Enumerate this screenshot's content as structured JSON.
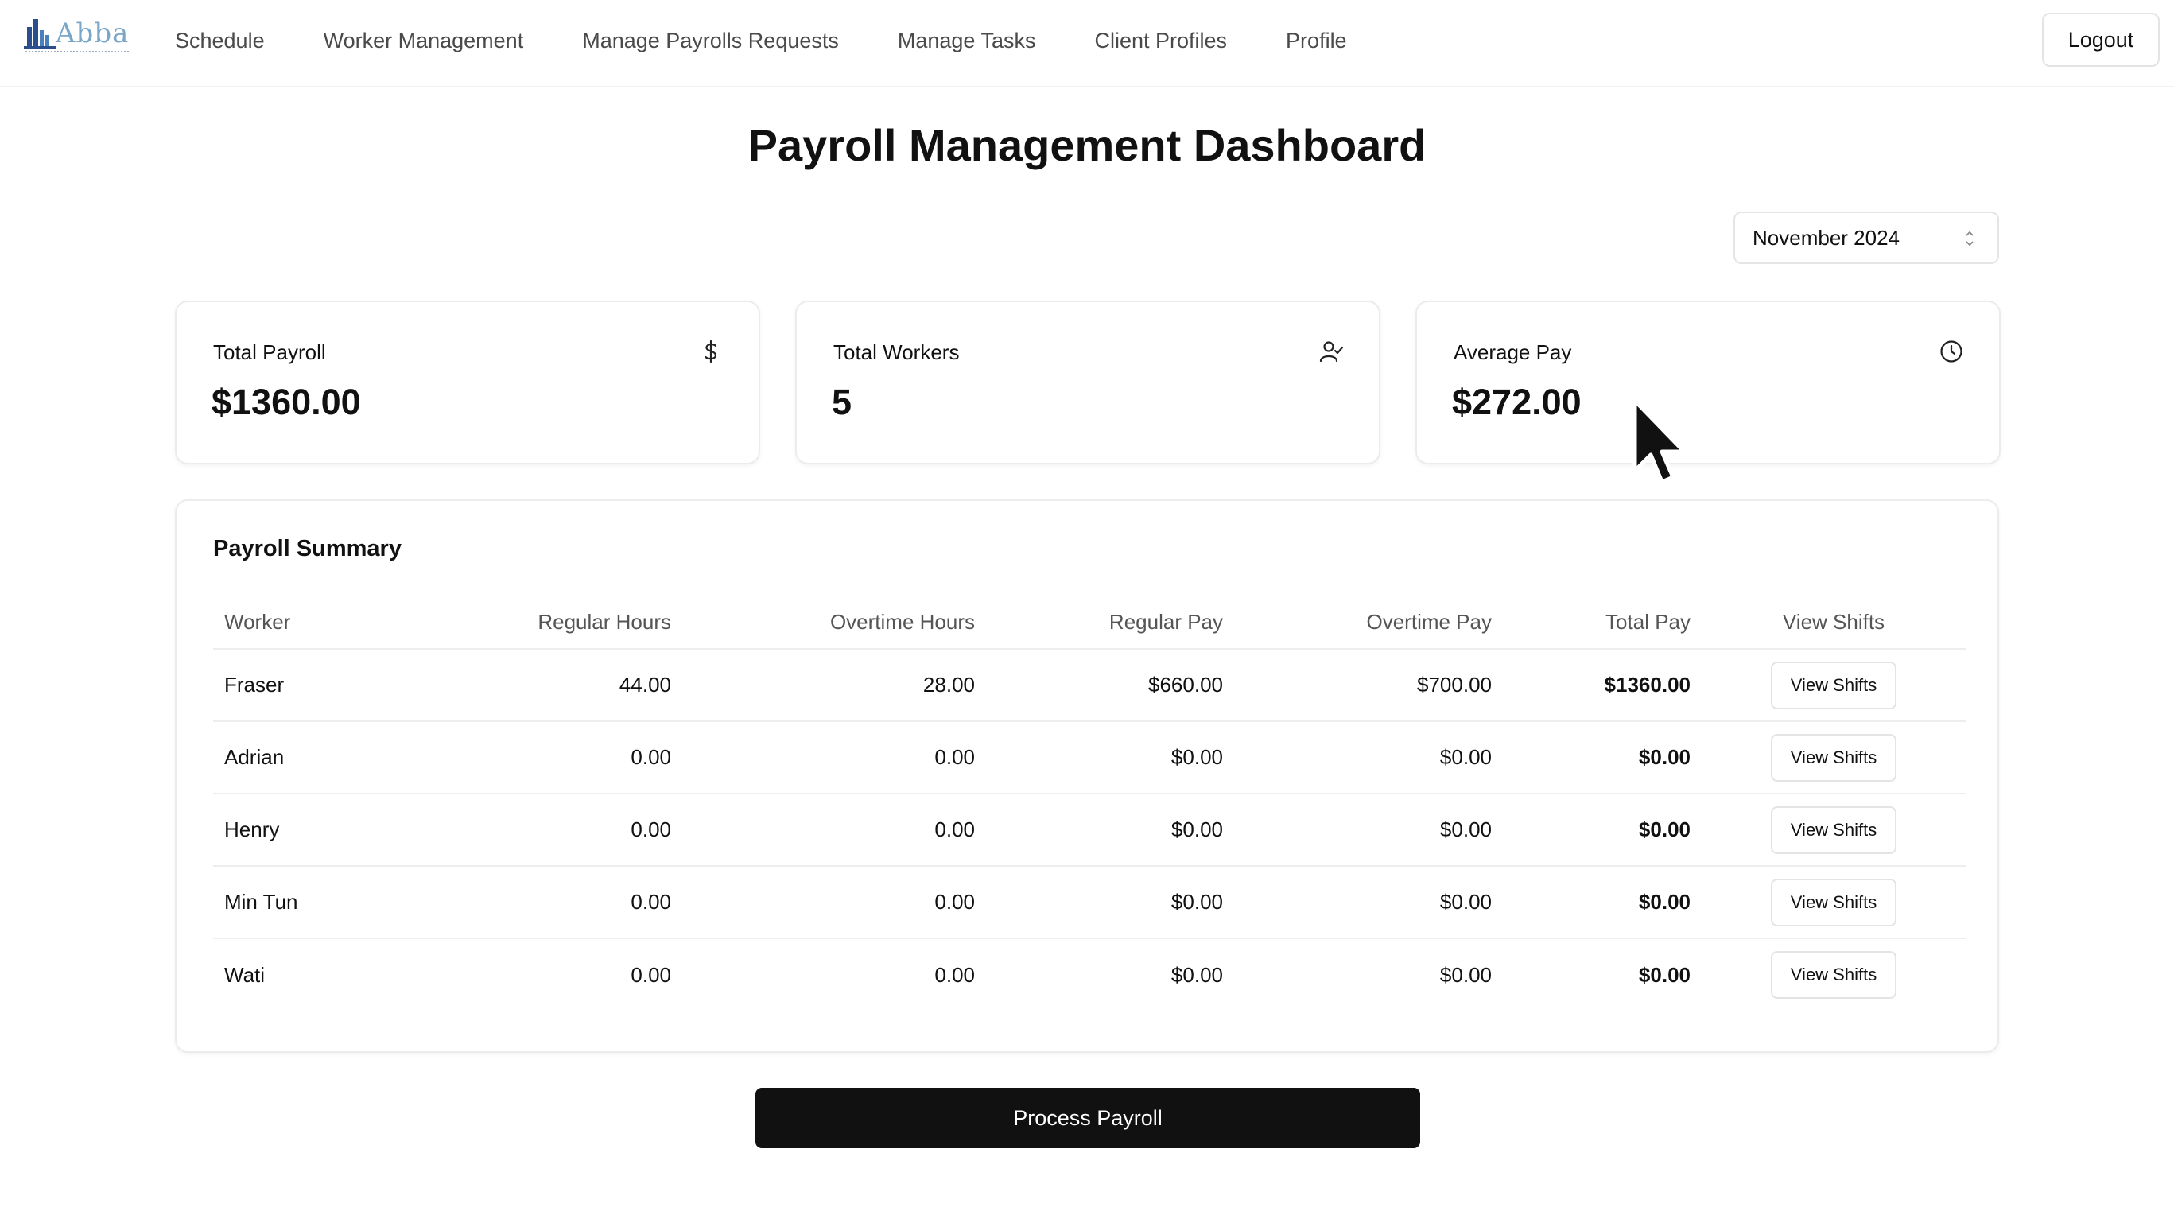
{
  "nav": {
    "logo_text": "Abba",
    "links": [
      "Schedule",
      "Worker Management",
      "Manage Payrolls Requests",
      "Manage Tasks",
      "Client Profiles",
      "Profile"
    ],
    "logout_label": "Logout"
  },
  "page": {
    "title": "Payroll Management Dashboard",
    "month_selected": "November 2024"
  },
  "stats": {
    "total_payroll": {
      "label": "Total Payroll",
      "value": "$1360.00",
      "icon": "dollar-icon"
    },
    "total_workers": {
      "label": "Total Workers",
      "value": "5",
      "icon": "user-icon"
    },
    "average_pay": {
      "label": "Average Pay",
      "value": "$272.00",
      "icon": "clock-icon"
    }
  },
  "summary": {
    "title": "Payroll Summary",
    "columns": [
      "Worker",
      "Regular Hours",
      "Overtime Hours",
      "Regular Pay",
      "Overtime Pay",
      "Total Pay",
      "View Shifts"
    ],
    "rows": [
      {
        "worker": "Fraser",
        "regular_hours": "44.00",
        "overtime_hours": "28.00",
        "regular_pay": "$660.00",
        "overtime_pay": "$700.00",
        "total_pay": "$1360.00",
        "action": "View Shifts"
      },
      {
        "worker": "Adrian",
        "regular_hours": "0.00",
        "overtime_hours": "0.00",
        "regular_pay": "$0.00",
        "overtime_pay": "$0.00",
        "total_pay": "$0.00",
        "action": "View Shifts"
      },
      {
        "worker": "Henry",
        "regular_hours": "0.00",
        "overtime_hours": "0.00",
        "regular_pay": "$0.00",
        "overtime_pay": "$0.00",
        "total_pay": "$0.00",
        "action": "View Shifts"
      },
      {
        "worker": "Min Tun",
        "regular_hours": "0.00",
        "overtime_hours": "0.00",
        "regular_pay": "$0.00",
        "overtime_pay": "$0.00",
        "total_pay": "$0.00",
        "action": "View Shifts"
      },
      {
        "worker": "Wati",
        "regular_hours": "0.00",
        "overtime_hours": "0.00",
        "regular_pay": "$0.00",
        "overtime_pay": "$0.00",
        "total_pay": "$0.00",
        "action": "View Shifts"
      }
    ]
  },
  "actions": {
    "process_label": "Process Payroll"
  },
  "colors": {
    "primary_button": "#111111",
    "nav_text": "#4a4a4a",
    "border": "#ececec",
    "logo": "#7aa6c8"
  }
}
